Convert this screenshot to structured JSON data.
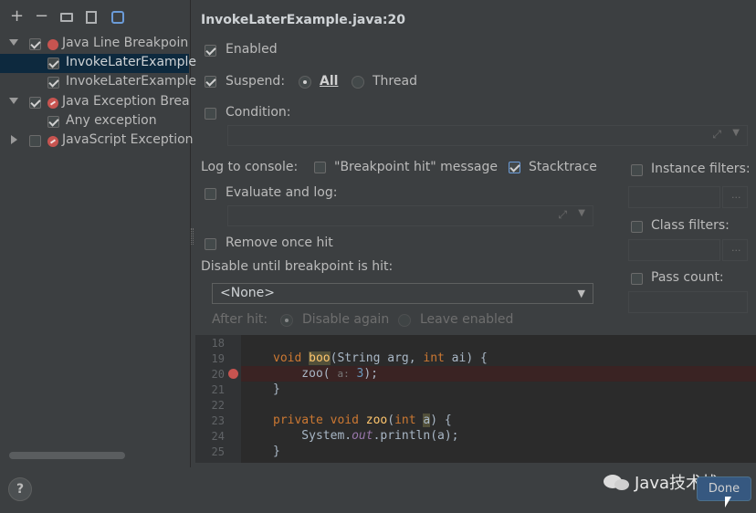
{
  "toolbar": {
    "icons": [
      "add-icon",
      "remove-icon",
      "folder-icon",
      "group-by-file-icon",
      "group-by-class-icon"
    ],
    "add": "+",
    "remove": "−"
  },
  "tree": {
    "items": [
      {
        "label": "Java Line Breakpoin",
        "checked": true,
        "expanded": true
      },
      {
        "label": "InvokeLaterExample",
        "checked": true,
        "selected": true
      },
      {
        "label": "InvokeLaterExample",
        "checked": true
      },
      {
        "label": "Java Exception Brea",
        "checked": true,
        "expanded": true
      },
      {
        "label": "Any exception",
        "checked": true
      },
      {
        "label": "JavaScript Exception",
        "checked": false,
        "expanded": false
      }
    ]
  },
  "detail": {
    "title": "InvokeLaterExample.java:20",
    "enabled": "Enabled",
    "suspend": "Suspend:",
    "suspend_all": "All",
    "suspend_thread": "Thread",
    "condition": "Condition:",
    "log_to_console": "Log to console:",
    "breakpoint_hit_message": "\"Breakpoint hit\" message",
    "stacktrace": "Stacktrace",
    "evaluate_and_log": "Evaluate and log:",
    "remove_once_hit": "Remove once hit",
    "disable_until": "Disable until breakpoint is hit:",
    "disable_select": "<None>",
    "after_hit": "After hit:",
    "disable_again": "Disable again",
    "leave_enabled": "Leave enabled",
    "instance_filters": "Instance filters:",
    "class_filters": "Class filters:",
    "pass_count": "Pass count:",
    "ellipsis": "..."
  },
  "code": {
    "lines": [
      "18",
      "19",
      "20",
      "21",
      "22",
      "23",
      "24",
      "25"
    ]
  },
  "footer": {
    "help": "?",
    "done": "Done",
    "watermark": "Java技术栈"
  },
  "colors": {
    "breakpoint": "#c75450",
    "selection": "#0d293e",
    "accent": "#cc7832"
  }
}
